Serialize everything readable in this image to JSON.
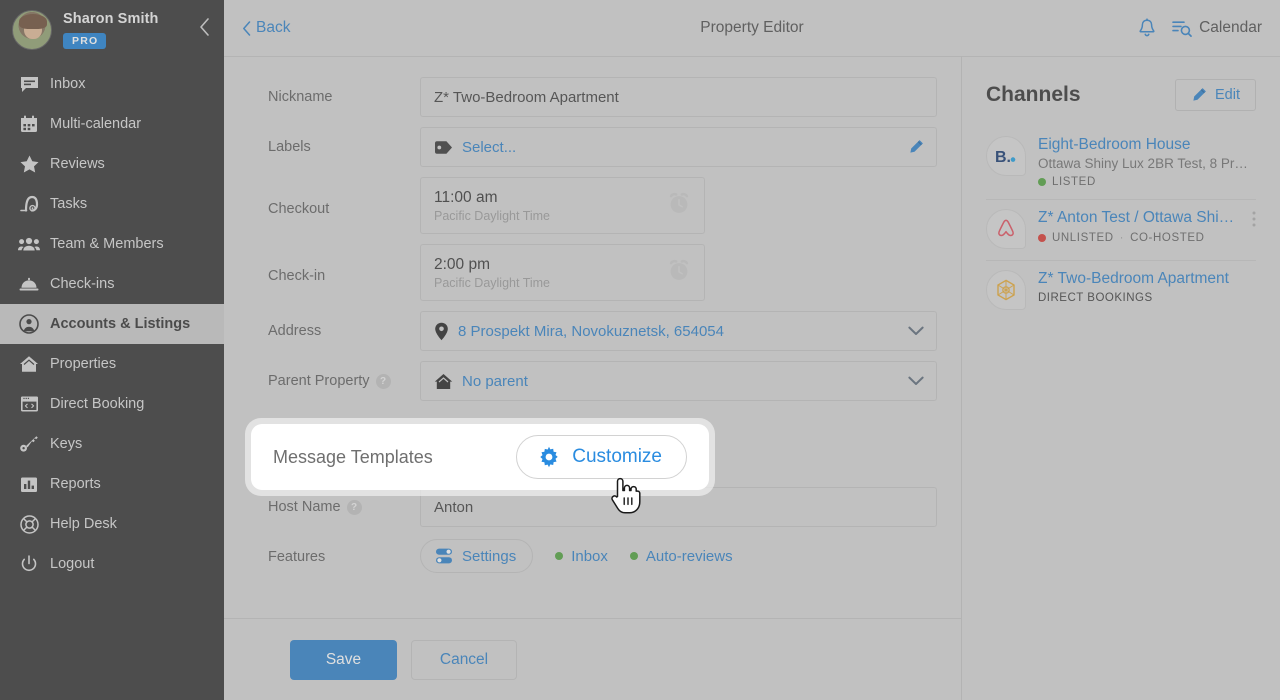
{
  "sidebar": {
    "user": {
      "name": "Sharon Smith",
      "badge": "PRO",
      "avatar_icon": "user-avatar"
    },
    "collapse_icon": "chevron-left-icon",
    "items": [
      {
        "label": "Inbox",
        "icon": "inbox-chat-icon",
        "active": false
      },
      {
        "label": "Multi-calendar",
        "icon": "calendar-icon",
        "active": false
      },
      {
        "label": "Reviews",
        "icon": "star-icon",
        "active": false
      },
      {
        "label": "Tasks",
        "icon": "vacuum-icon",
        "active": false
      },
      {
        "label": "Team & Members",
        "icon": "people-icon",
        "active": false
      },
      {
        "label": "Check-ins",
        "icon": "bell-service-icon",
        "active": false
      },
      {
        "label": "Accounts & Listings",
        "icon": "user-circle-icon",
        "active": true
      },
      {
        "label": "Properties",
        "icon": "home-icon",
        "active": false
      },
      {
        "label": "Direct Booking",
        "icon": "browser-code-icon",
        "active": false
      },
      {
        "label": "Keys",
        "icon": "key-icon",
        "active": false
      },
      {
        "label": "Reports",
        "icon": "bar-chart-icon",
        "active": false
      }
    ],
    "bottom_items": [
      {
        "label": "Help Desk",
        "icon": "lifebuoy-icon"
      },
      {
        "label": "Logout",
        "icon": "power-icon"
      }
    ]
  },
  "topbar": {
    "back_label": "Back",
    "back_icon": "chevron-left-icon",
    "title": "Property Editor",
    "bell_icon": "notification-bell-icon",
    "calendar_label": "Calendar",
    "calendar_icon": "list-search-icon"
  },
  "form": {
    "fields": [
      {
        "label": "Nickname",
        "value": "Z* Two-Bedroom Apartment",
        "type": "text"
      },
      {
        "label": "Labels",
        "value": "Select...",
        "type": "select-link",
        "icon": "tag-icon",
        "action_icon": "pencil-icon"
      },
      {
        "label": "Checkout",
        "value": "11:00 am",
        "sub": "Pacific Daylight Time",
        "type": "time",
        "icon": "alarm-clock-icon"
      },
      {
        "label": "Check-in",
        "value": "2:00 pm",
        "sub": "Pacific Daylight Time",
        "type": "time",
        "icon": "alarm-clock-icon"
      },
      {
        "label": "Address",
        "value": "8 Prospekt Mira, Novokuznetsk, 654054",
        "type": "dropdown-link",
        "icon": "map-pin-icon",
        "action_icon": "chevron-down-icon"
      },
      {
        "label": "Parent Property",
        "value": "No parent",
        "type": "dropdown-link",
        "icon": "home-icon",
        "action_icon": "chevron-down-icon",
        "help": "?"
      },
      {
        "label": "Host Name",
        "value": "Anton",
        "type": "text",
        "help": "?"
      }
    ],
    "features": {
      "label": "Features",
      "settings_label": "Settings",
      "settings_icon": "toggles-icon",
      "links": [
        {
          "label": "Inbox",
          "dot_color": "#4ca13a"
        },
        {
          "label": "Auto-reviews",
          "dot_color": "#4ca13a"
        }
      ]
    },
    "footer": {
      "save_label": "Save",
      "cancel_label": "Cancel"
    }
  },
  "highlight": {
    "label": "Message Templates",
    "button_label": "Customize",
    "button_icon": "gear-icon",
    "cursor_icon": "pointing-hand-cursor"
  },
  "channels": {
    "title": "Channels",
    "edit_label": "Edit",
    "edit_icon": "pencil-icon",
    "more_icon": "dots-vertical-icon",
    "items": [
      {
        "name": "Eight-Bedroom House",
        "sub": "Ottawa Shiny Lux 2BR Test, 8 Pros…",
        "status": "LISTED",
        "status_color": "#4ca13a",
        "logo_icon": "booking-com-icon",
        "has_more": false
      },
      {
        "name": "Z* Anton Test / Ottawa Shi…",
        "sub": "",
        "status": "UNLISTED",
        "status_color": "#d8342d",
        "extra": "CO-HOSTED",
        "separator": "·",
        "logo_icon": "airbnb-icon",
        "has_more": true
      },
      {
        "name": "Z* Two-Bedroom Apartment",
        "sub": "",
        "direct": "DIRECT BOOKINGS",
        "logo_icon": "direct-booking-hexagon-icon",
        "has_more": false
      }
    ]
  },
  "colors": {
    "accent_blue": "#2a7fc9",
    "sidebar_bg": "#2e2e2e",
    "page_bg": "#d4d4d4",
    "green": "#4ca13a",
    "red": "#d8342d",
    "pro_badge": "#1a7fd4"
  }
}
